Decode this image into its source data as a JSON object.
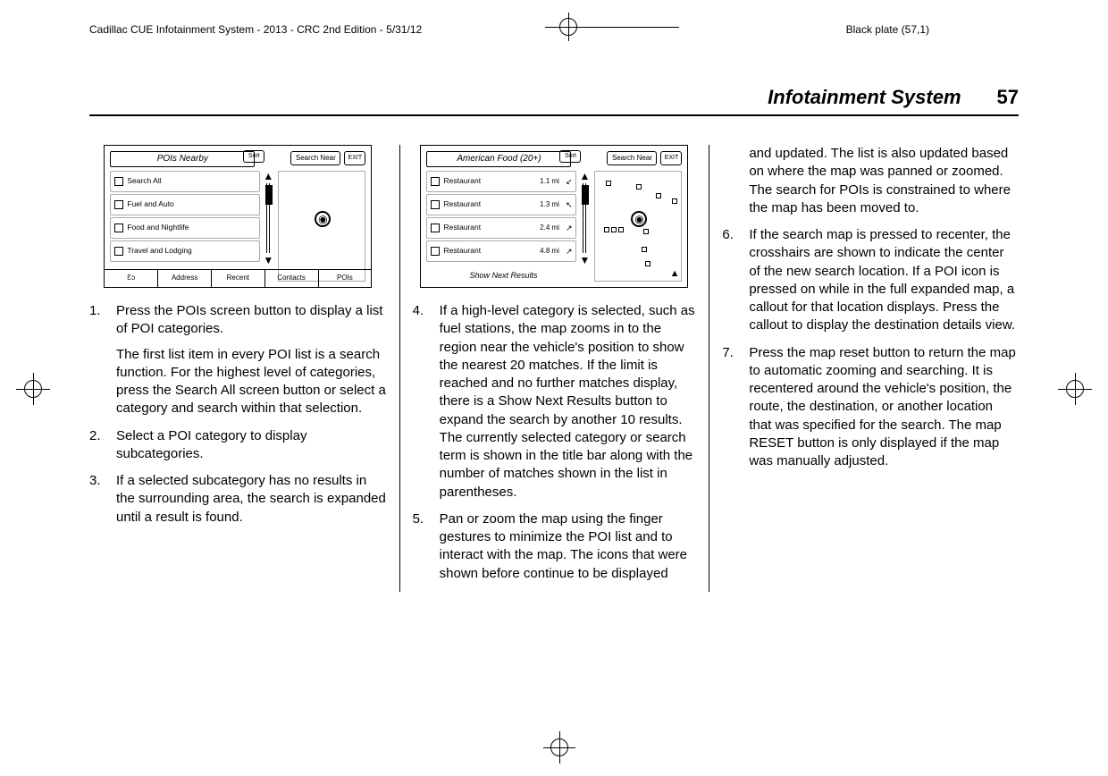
{
  "header_line": "Cadillac CUE Infotainment System - 2013 - CRC 2nd Edition - 5/31/12",
  "plate_text": "Black plate (57,1)",
  "running_head": {
    "title": "Infotainment System",
    "page": "57"
  },
  "figure1": {
    "title": "POIs Nearby",
    "sort": "Sort",
    "search_near": "Search Near",
    "exit": "EXIT",
    "rows": [
      "Search All",
      "Fuel and Auto",
      "Food and Nightlife",
      "Travel and Lodging"
    ],
    "tabs": [
      "Ɛɔ",
      "Address",
      "Recent",
      "Contacts",
      "POIs"
    ]
  },
  "figure2": {
    "title": "American Food (20+)",
    "sort": "Sort",
    "search_near": "Search Near",
    "exit": "EXIT",
    "rows": [
      {
        "name": "Restaurant",
        "dist": "1.1 mi",
        "arr": "↙"
      },
      {
        "name": "Restaurant",
        "dist": "1.3 mi",
        "arr": "↖"
      },
      {
        "name": "Restaurant",
        "dist": "2.4 mi",
        "arr": "↗"
      },
      {
        "name": "Restaurant",
        "dist": "4.8 mi",
        "arr": "↗"
      }
    ],
    "show_next": "Show Next Results"
  },
  "col1": {
    "s1": "Press the POIs screen button to display a list of POI categories.",
    "s1b": "The first list item in every POI list is a search function. For the highest level of categories, press the Search All screen button or select a category and search within that selection.",
    "s2": "Select a POI category to display subcategories.",
    "s3": "If a selected subcategory has no results in the surrounding area, the search is expanded until a result is found."
  },
  "col2": {
    "s4": "If a high-level category is selected, such as fuel stations, the map zooms in to the region near the vehicle's position to show the nearest 20 matches. If the limit is reached and no further matches display, there is a Show Next Results button to expand the search by another 10 results. The currently selected category or search term is shown in the title bar along with the number of matches shown in the list in parentheses.",
    "s5": "Pan or zoom the map using the finger gestures to minimize the POI list and to interact with the map. The icons that were shown before continue to be displayed"
  },
  "col3": {
    "cont": "and updated. The list is also updated based on where the map was panned or zoomed. The search for POIs is constrained to where the map has been moved to.",
    "s6": "If the search map is pressed to recenter, the crosshairs are shown to indicate the center of the new search location. If a POI icon is pressed on while in the full expanded map, a callout for that location displays. Press the callout to display the destination details view.",
    "s7": "Press the map reset button to return the map to automatic zooming and searching. It is recentered around the vehicle's position, the route, the destination, or another location that was specified for the search. The map RESET button is only displayed if the map was manually adjusted."
  }
}
